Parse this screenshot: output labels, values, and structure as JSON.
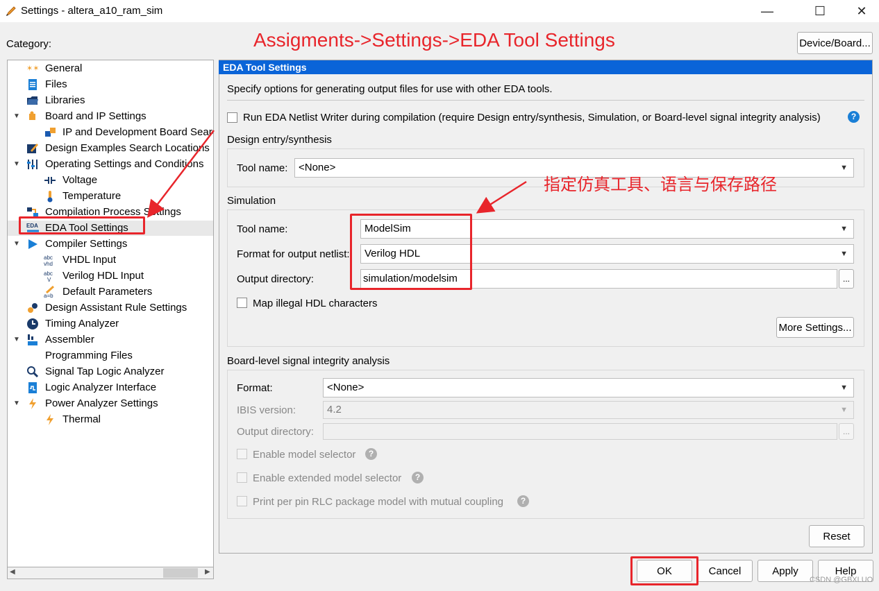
{
  "window": {
    "title": "Settings - altera_a10_ram_sim",
    "controls": {
      "minimize": "—",
      "maximize": "☐",
      "close": "✕"
    }
  },
  "category_label": "Category:",
  "device_board_button": "Device/Board...",
  "annotations": {
    "top": "Assigments->Settings->EDA Tool Settings",
    "chinese": "指定仿真工具、语言与保存路径"
  },
  "tree": [
    {
      "label": "General",
      "icon": "general-stars-icon",
      "indent": 0,
      "expand": ""
    },
    {
      "label": "Files",
      "icon": "file-icon",
      "indent": 0,
      "expand": ""
    },
    {
      "label": "Libraries",
      "icon": "folder-icon",
      "indent": 0,
      "expand": ""
    },
    {
      "label": "Board and IP Settings",
      "icon": "puzzle-icon",
      "indent": 0,
      "expand": "▼"
    },
    {
      "label": "IP and Development Board Search",
      "icon": "ip-puzzle-icon",
      "indent": 1,
      "expand": ""
    },
    {
      "label": "Design Examples Search Locations",
      "icon": "pencil-icon",
      "indent": 0,
      "expand": ""
    },
    {
      "label": "Operating Settings and Conditions",
      "icon": "conditions-icon",
      "indent": 0,
      "expand": "▼"
    },
    {
      "label": "Voltage",
      "icon": "voltage-icon",
      "indent": 1,
      "expand": ""
    },
    {
      "label": "Temperature",
      "icon": "thermometer-icon",
      "indent": 1,
      "expand": ""
    },
    {
      "label": "Compilation Process Settings",
      "icon": "compilation-icon",
      "indent": 0,
      "expand": ""
    },
    {
      "label": "EDA Tool Settings",
      "icon": "eda-icon",
      "indent": 0,
      "expand": "",
      "selected": true
    },
    {
      "label": "Compiler Settings",
      "icon": "play-icon",
      "indent": 0,
      "expand": "▼"
    },
    {
      "label": "VHDL Input",
      "icon": "vhdl-icon",
      "indent": 1,
      "expand": ""
    },
    {
      "label": "Verilog HDL Input",
      "icon": "verilog-icon",
      "indent": 1,
      "expand": ""
    },
    {
      "label": "Default Parameters",
      "icon": "parameters-icon",
      "indent": 1,
      "expand": ""
    },
    {
      "label": "Design Assistant Rule Settings",
      "icon": "gears-icon",
      "indent": 0,
      "expand": ""
    },
    {
      "label": "Timing Analyzer",
      "icon": "clock-icon",
      "indent": 0,
      "expand": ""
    },
    {
      "label": "Assembler",
      "icon": "assembler-icon",
      "indent": 0,
      "expand": "▼"
    },
    {
      "label": "Programming Files",
      "icon": "",
      "indent": 0,
      "expand": ""
    },
    {
      "label": "Signal Tap Logic Analyzer",
      "icon": "signal-tap-icon",
      "indent": 0,
      "expand": ""
    },
    {
      "label": "Logic Analyzer Interface",
      "icon": "analyzer-file-icon",
      "indent": 0,
      "expand": ""
    },
    {
      "label": "Power Analyzer Settings",
      "icon": "lightning-icon",
      "indent": 0,
      "expand": "▼"
    },
    {
      "label": "Thermal",
      "icon": "lightning-icon",
      "indent": 1,
      "expand": ""
    }
  ],
  "panel": {
    "header": "EDA Tool Settings",
    "description": "Specify options for generating output files for use with other EDA tools.",
    "run_netlist_writer": "Run EDA Netlist Writer during compilation (require Design entry/synthesis, Simulation, or Board-level signal integrity analysis)",
    "design_entry": {
      "title": "Design entry/synthesis",
      "tool_name_label": "Tool name:",
      "tool_name_value": "<None>"
    },
    "simulation": {
      "title": "Simulation",
      "tool_name_label": "Tool name:",
      "tool_name_value": "ModelSim",
      "format_label": "Format for output netlist:",
      "format_value": "Verilog HDL",
      "output_dir_label": "Output directory:",
      "output_dir_value": "simulation/modelsim",
      "browse": "...",
      "map_illegal": "Map illegal HDL characters",
      "more_settings": "More Settings..."
    },
    "board_level": {
      "title": "Board-level signal integrity analysis",
      "format_label": "Format:",
      "format_value": "<None>",
      "ibis_label": "IBIS version:",
      "ibis_value": "4.2",
      "output_dir_label": "Output directory:",
      "output_dir_value": "",
      "browse": "...",
      "enable_model_selector": "Enable model selector",
      "enable_extended": "Enable extended model selector",
      "print_rlc": "Print per pin RLC package model with mutual coupling"
    },
    "reset": "Reset"
  },
  "buttons": {
    "ok": "OK",
    "cancel": "Cancel",
    "apply": "Apply",
    "help": "Help"
  },
  "watermark": "CSDN @GBXLUO",
  "colors": {
    "selection": "#0a64d8",
    "annotation": "#e8252b"
  }
}
